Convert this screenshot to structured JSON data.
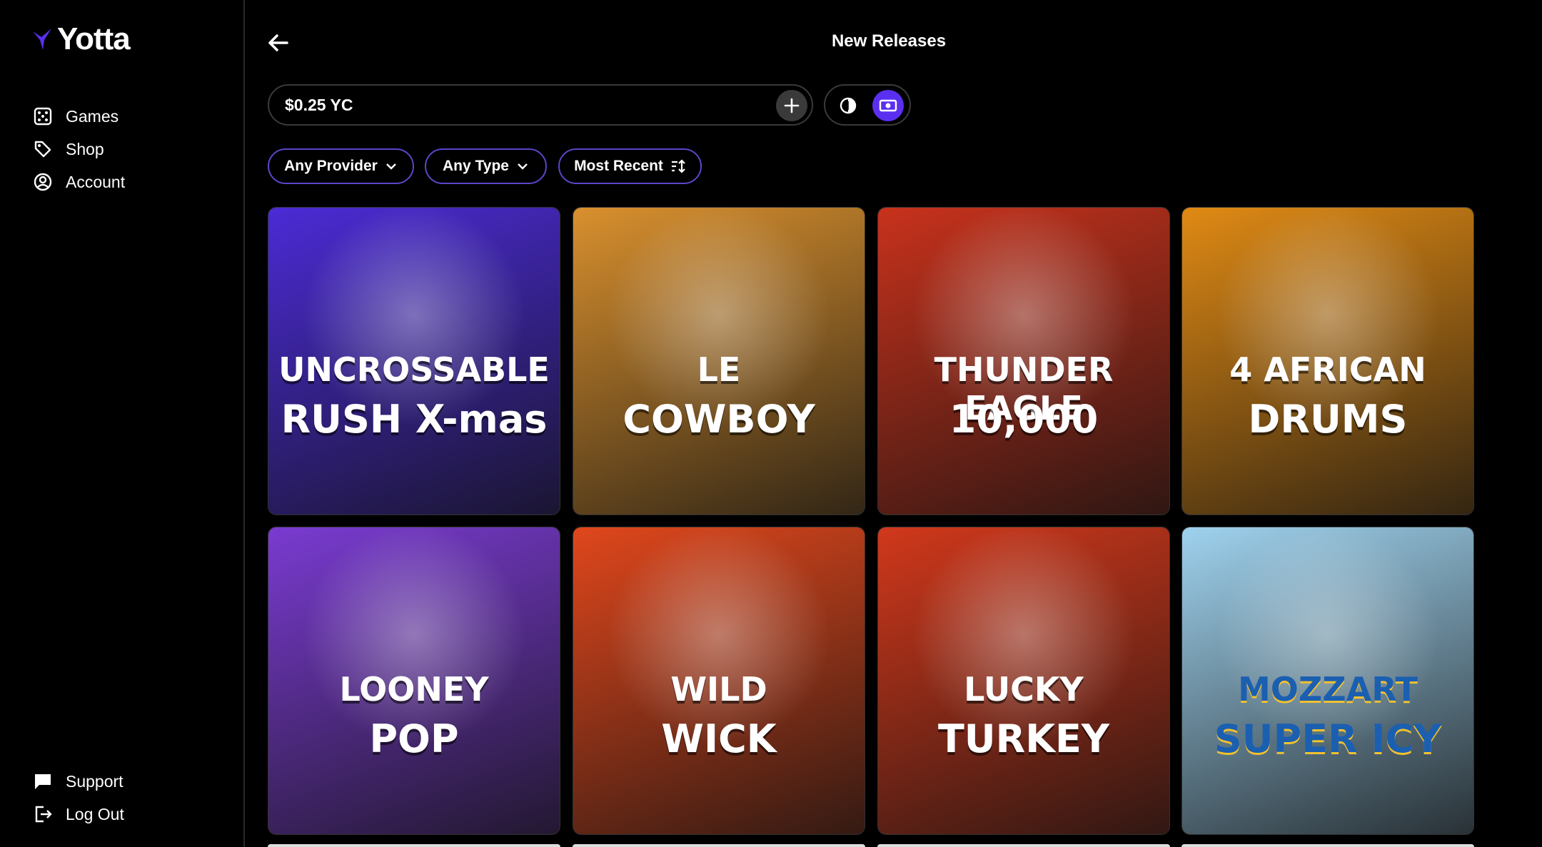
{
  "app": {
    "name": "Yotta"
  },
  "sidebar": {
    "items": [
      {
        "label": "Games",
        "icon": "dice-icon"
      },
      {
        "label": "Shop",
        "icon": "tag-icon"
      },
      {
        "label": "Account",
        "icon": "user-circle-icon"
      }
    ],
    "bottom_items": [
      {
        "label": "Support",
        "icon": "chat-bubble-icon"
      },
      {
        "label": "Log Out",
        "icon": "logout-icon"
      }
    ]
  },
  "header": {
    "title": "New Releases",
    "back_icon": "arrow-left-icon"
  },
  "wager": {
    "value": "$0.25 YC",
    "add_icon": "plus-icon"
  },
  "mode_toggle": {
    "options": [
      "contrast-icon",
      "cash-icon"
    ],
    "selected": "cash-icon"
  },
  "filters": [
    {
      "label": "Any Provider",
      "icon": "chevron-down-icon"
    },
    {
      "label": "Any Type",
      "icon": "chevron-down-icon"
    },
    {
      "label": "Most Recent",
      "icon": "sort-icon"
    }
  ],
  "games": [
    {
      "line1": "UNCROSSABLE",
      "line2": "RUSH X-mas",
      "accent": "#4b2bd6"
    },
    {
      "line1": "LE",
      "line2": "COWBOY",
      "accent": "#d9902e"
    },
    {
      "line1": "THUNDER EAGLE",
      "line2": "10,000",
      "accent": "#c8321c"
    },
    {
      "line1": "4 AFRICAN",
      "line2": "DRUMS",
      "accent": "#e08a14"
    },
    {
      "line1": "LOONEY",
      "line2": "POP",
      "accent": "#7a3bd1"
    },
    {
      "line1": "WILD",
      "line2": "WICK",
      "accent": "#e0471c"
    },
    {
      "line1": "LUCKY",
      "line2": "TURKEY",
      "accent": "#d1381b"
    },
    {
      "line1": "MOZZART",
      "line2": "SUPER ICY",
      "accent": "#9fd2ee"
    }
  ],
  "colors": {
    "accent": "#5b2ff0",
    "filter_border": "#5b46c9",
    "background": "#000000"
  }
}
